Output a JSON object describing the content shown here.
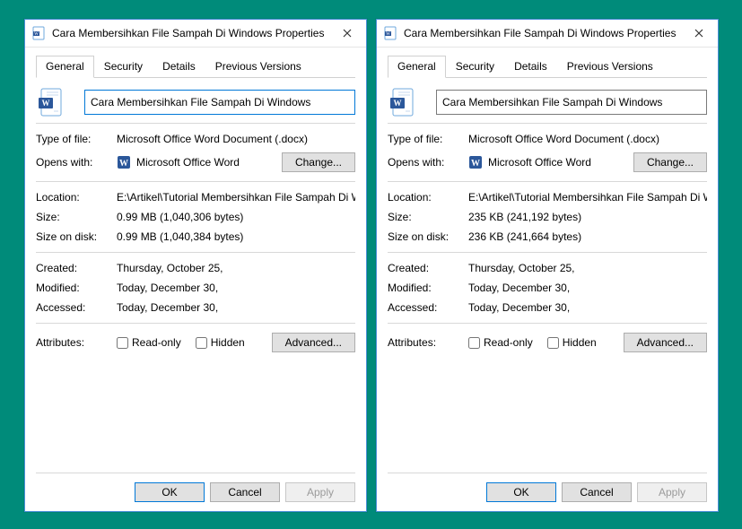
{
  "dialogs": [
    {
      "title": "Cara Membersihkan File Sampah Di Windows Properties",
      "tabs": [
        "General",
        "Security",
        "Details",
        "Previous Versions"
      ],
      "active_tab": "General",
      "filename": "Cara Membersihkan File Sampah Di Windows",
      "type_label": "Type of file:",
      "type_value": "Microsoft Office Word Document (.docx)",
      "opens_label": "Opens with:",
      "opens_value": "Microsoft Office Word",
      "change_btn": "Change...",
      "location_label": "Location:",
      "location_value": "E:\\Artikel\\Tutorial Membersihkan File Sampah Di Wi",
      "size_label": "Size:",
      "size_value": "0.99 MB (1,040,306 bytes)",
      "sizedisk_label": "Size on disk:",
      "sizedisk_value": "0.99 MB (1,040,384 bytes)",
      "created_label": "Created:",
      "created_value": "Thursday, October 25,",
      "modified_label": "Modified:",
      "modified_value": "Today, December 30,",
      "accessed_label": "Accessed:",
      "accessed_value": "Today, December 30,",
      "attributes_label": "Attributes:",
      "readonly_label": "Read-only",
      "hidden_label": "Hidden",
      "advanced_btn": "Advanced...",
      "ok_btn": "OK",
      "cancel_btn": "Cancel",
      "apply_btn": "Apply",
      "name_focused": true
    },
    {
      "title": "Cara Membersihkan File Sampah Di Windows Properties",
      "tabs": [
        "General",
        "Security",
        "Details",
        "Previous Versions"
      ],
      "active_tab": "General",
      "filename": "Cara Membersihkan File Sampah Di Windows",
      "type_label": "Type of file:",
      "type_value": "Microsoft Office Word Document (.docx)",
      "opens_label": "Opens with:",
      "opens_value": "Microsoft Office Word",
      "change_btn": "Change...",
      "location_label": "Location:",
      "location_value": "E:\\Artikel\\Tutorial Membersihkan File Sampah Di Wi",
      "size_label": "Size:",
      "size_value": "235 KB (241,192 bytes)",
      "sizedisk_label": "Size on disk:",
      "sizedisk_value": "236 KB (241,664 bytes)",
      "created_label": "Created:",
      "created_value": "Thursday, October 25,",
      "modified_label": "Modified:",
      "modified_value": "Today, December 30,",
      "accessed_label": "Accessed:",
      "accessed_value": "Today, December 30,",
      "attributes_label": "Attributes:",
      "readonly_label": "Read-only",
      "hidden_label": "Hidden",
      "advanced_btn": "Advanced...",
      "ok_btn": "OK",
      "cancel_btn": "Cancel",
      "apply_btn": "Apply",
      "name_focused": false
    }
  ]
}
